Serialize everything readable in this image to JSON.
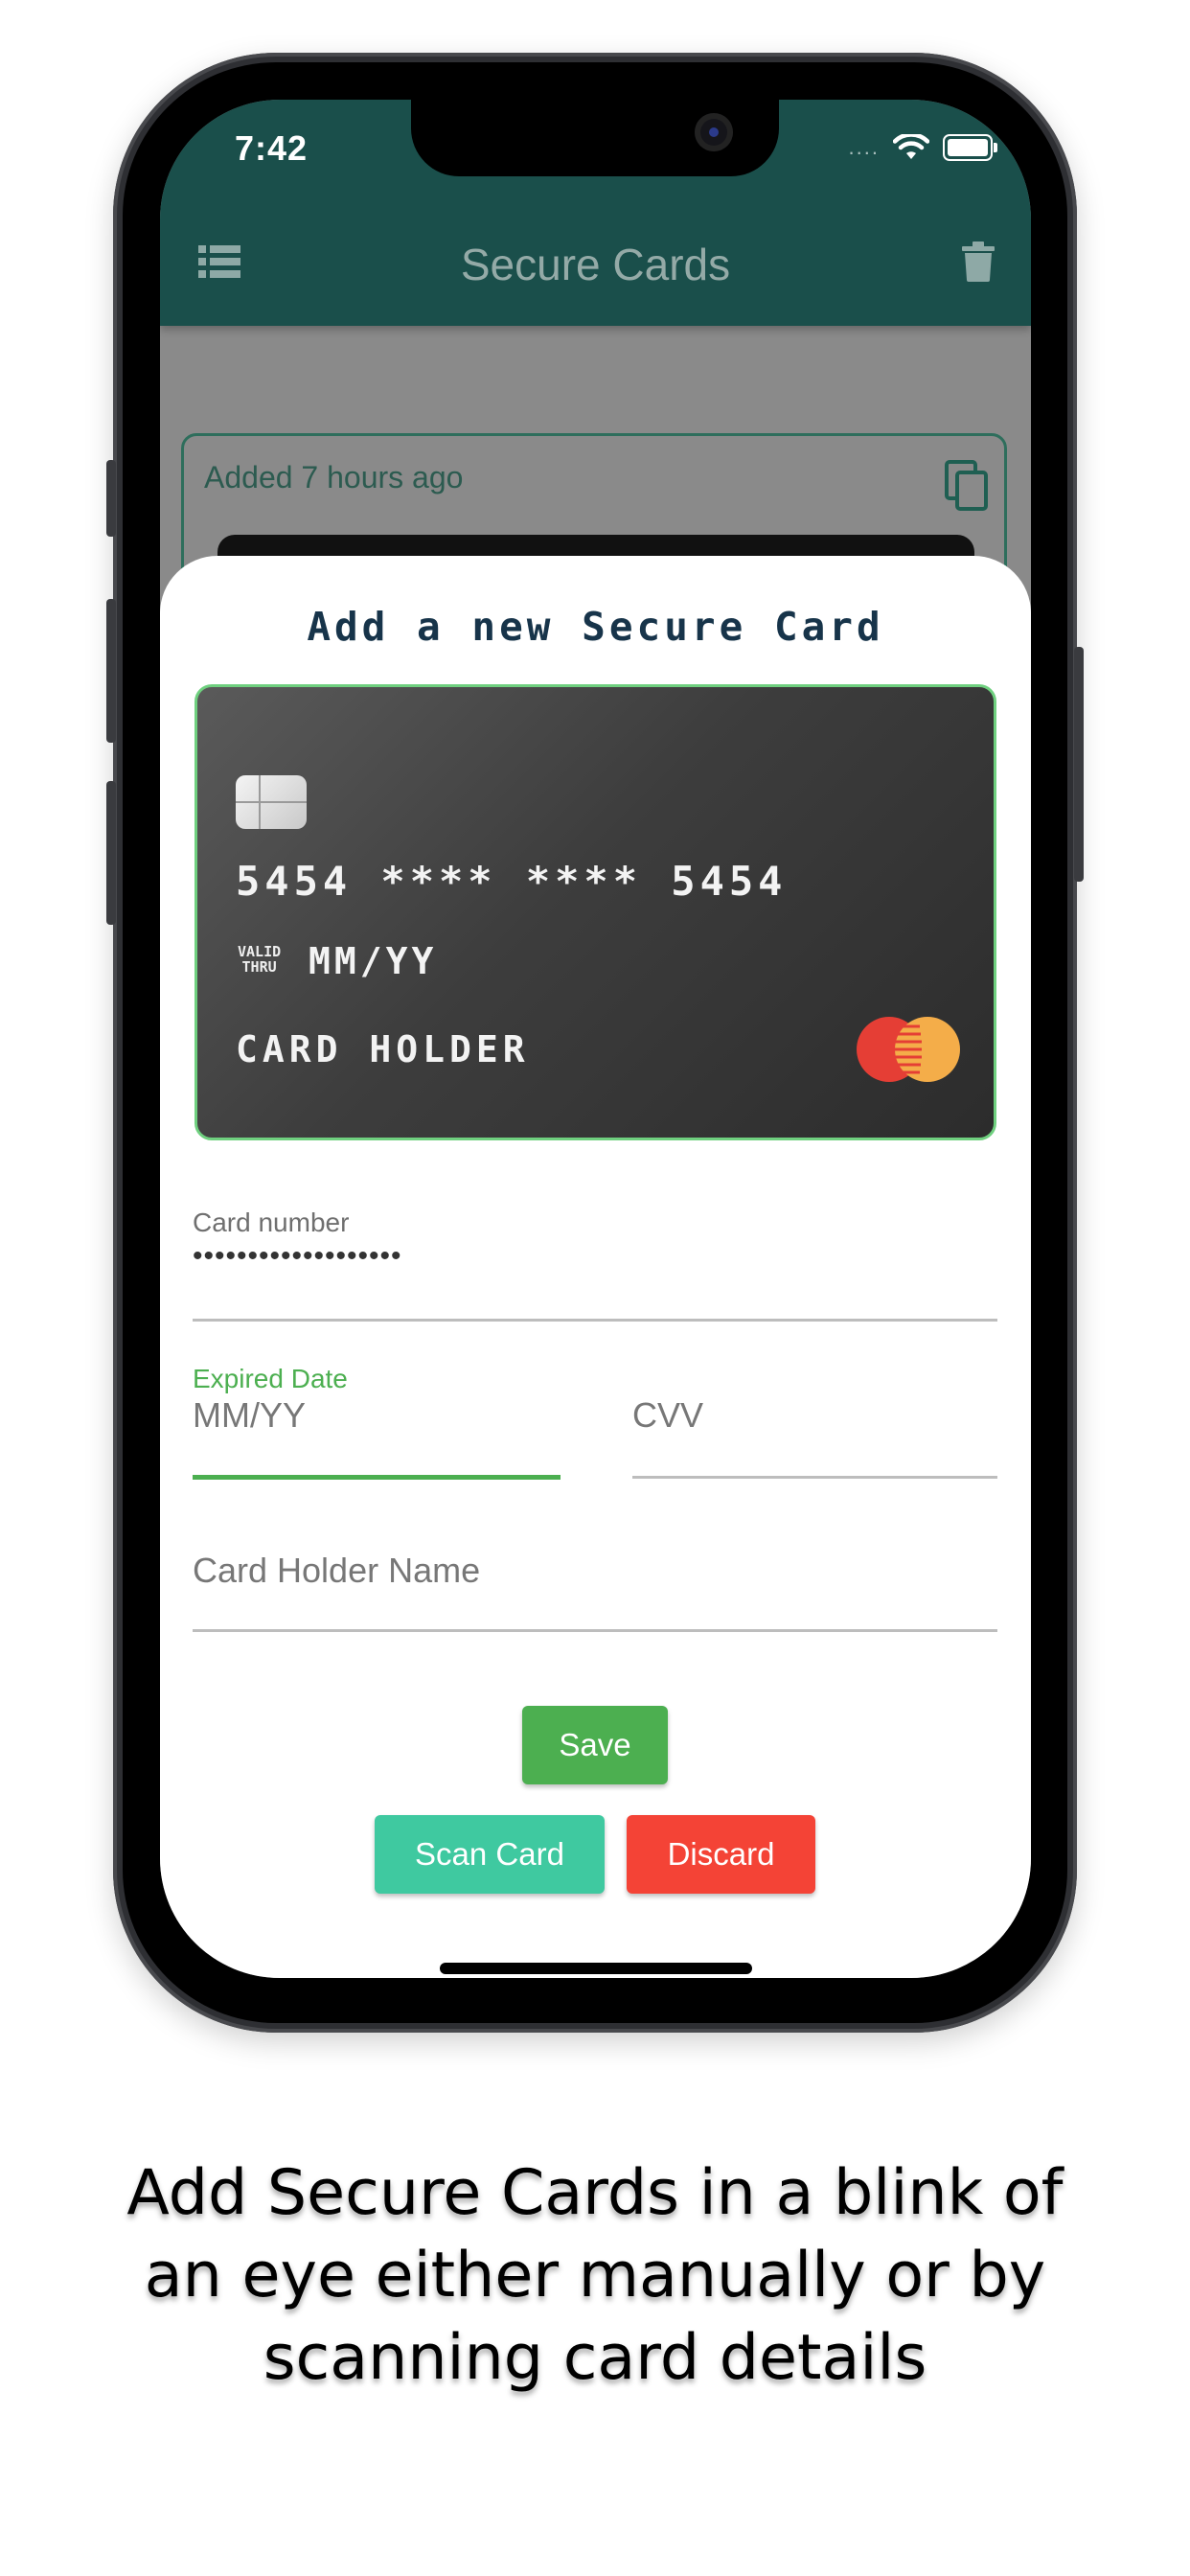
{
  "status_bar": {
    "time": "7:42",
    "signal_dots": "....",
    "icons": [
      "wifi-icon",
      "battery-icon"
    ]
  },
  "app_bar": {
    "title": "Secure Cards",
    "left_icon": "list-icon",
    "right_icon": "trash-icon"
  },
  "background_list": {
    "card_added": "Added 7 hours ago",
    "icon": "copy-icon"
  },
  "sheet": {
    "title": "Add a new Secure Card",
    "card_preview": {
      "number": "5454 **** **** 5454",
      "valid_line1": "VALID",
      "valid_line2": "THRU",
      "expiry": "MM/YY",
      "holder": "CARD HOLDER",
      "network_icon": "mastercard-logo"
    },
    "fields": {
      "card_number_label": "Card number",
      "card_number_value": "•••••••••••••••••••",
      "expired_label": "Expired Date",
      "expired_placeholder": "MM/YY",
      "cvv_placeholder": "CVV",
      "holder_placeholder": "Card Holder Name"
    },
    "buttons": {
      "save": "Save",
      "scan": "Scan Card",
      "discard": "Discard"
    }
  },
  "caption": {
    "line1": "Add Secure Cards in a blink of",
    "line2": "an eye either manually or by",
    "line3": "scanning card details"
  },
  "colors": {
    "app_bar": "#1a4f4b",
    "accent_green": "#4caf50",
    "scan_button": "#3fc9a0",
    "discard_button": "#f44336",
    "card_background": "#3d3d3d"
  }
}
